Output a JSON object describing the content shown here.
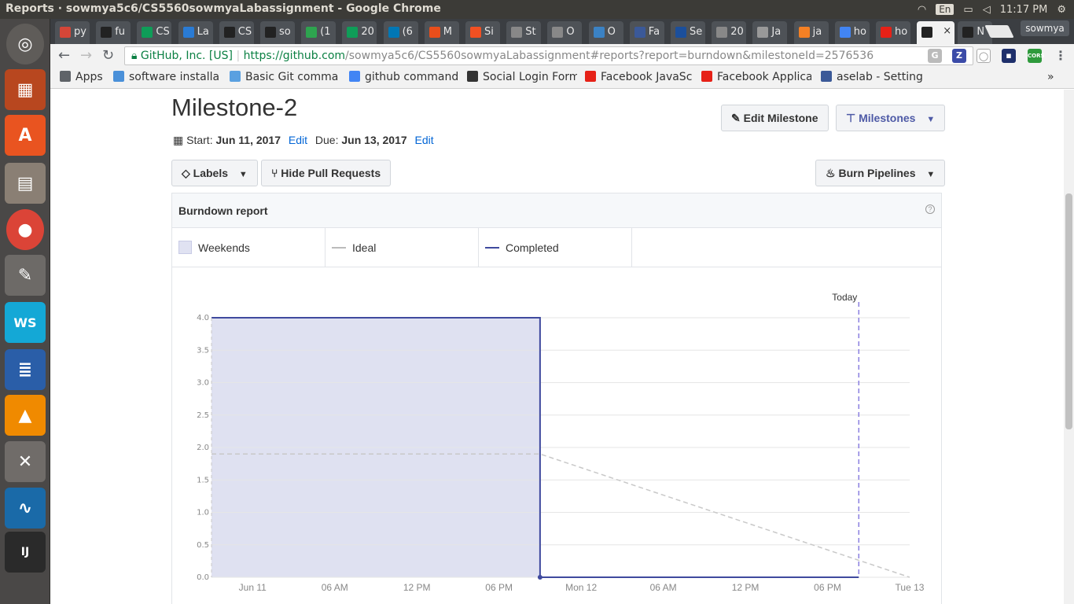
{
  "os": {
    "window_title": "Reports · sowmya5c6/CS5560sowmyaLabassignment - Google Chrome",
    "input_lang": "En",
    "clock": "11:17 PM"
  },
  "browser": {
    "tabs": [
      {
        "label": "py",
        "icon": "gmail-icon",
        "color": "#d44638"
      },
      {
        "label": "fu",
        "icon": "github-icon",
        "color": "#222"
      },
      {
        "label": "CS",
        "icon": "sheets-icon",
        "color": "#0f9d58"
      },
      {
        "label": "La",
        "icon": "blogger-icon",
        "color": "#2a7bd4"
      },
      {
        "label": "CS",
        "icon": "github-icon",
        "color": "#222"
      },
      {
        "label": "so",
        "icon": "github-icon",
        "color": "#222"
      },
      {
        "label": "(1",
        "icon": "badge-icon",
        "color": "#2ea44f"
      },
      {
        "label": "20",
        "icon": "sheets-icon",
        "color": "#0f9d58"
      },
      {
        "label": "(6",
        "icon": "linkedin-icon",
        "color": "#0077b5"
      },
      {
        "label": "M",
        "icon": "office-icon",
        "color": "#e84e1b"
      },
      {
        "label": "Si",
        "icon": "microsoft-icon",
        "color": "#f25022"
      },
      {
        "label": "St",
        "icon": "page-icon",
        "color": "#888"
      },
      {
        "label": "O",
        "icon": "page-icon",
        "color": "#888"
      },
      {
        "label": "O",
        "icon": "user-icon",
        "color": "#3b82c4"
      },
      {
        "label": "Fa",
        "icon": "facebook-icon",
        "color": "#3b5998"
      },
      {
        "label": "Se",
        "icon": "nav-icon",
        "color": "#1b4f9c"
      },
      {
        "label": "20",
        "icon": "page-icon",
        "color": "#888"
      },
      {
        "label": "Ja",
        "icon": "image-icon",
        "color": "#999"
      },
      {
        "label": "ja",
        "icon": "stackoverflow-icon",
        "color": "#f48024"
      },
      {
        "label": "ho",
        "icon": "google-icon",
        "color": "#4285f4"
      },
      {
        "label": "ho",
        "icon": "youtube-icon",
        "color": "#e62117"
      },
      {
        "label": "",
        "icon": "github-icon",
        "color": "#222"
      },
      {
        "label": "N",
        "icon": "github-icon",
        "color": "#222"
      }
    ],
    "profile": "sowmya",
    "omnibox": {
      "security": "GitHub, Inc. [US]",
      "scheme_host": "https://github.com",
      "path": "/sowmya5c6/CS5560sowmyaLabassignment#reports?report=burndown&milestoneId=2576536"
    },
    "bookmarks": [
      {
        "label": "Apps",
        "color": "#5f6368"
      },
      {
        "label": "software installa",
        "color": "#4a90d9"
      },
      {
        "label": "Basic Git comma",
        "color": "#5aa0e0"
      },
      {
        "label": "github command",
        "color": "#4285f4"
      },
      {
        "label": "Social Login Form",
        "color": "#333"
      },
      {
        "label": "Facebook JavaSc",
        "color": "#e62117"
      },
      {
        "label": "Facebook Applica",
        "color": "#e62117"
      },
      {
        "label": "aselab - Settings",
        "color": "#3b5998"
      }
    ]
  },
  "milestone": {
    "title": "Milestone-2",
    "start_label": "Start:",
    "start_date": "Jun 11, 2017",
    "due_label": "Due:",
    "due_date": "Jun 13, 2017",
    "edit": "Edit",
    "edit_button": "Edit Milestone",
    "milestones_button": "Milestones"
  },
  "toolbar": {
    "labels_button": "Labels",
    "hide_pr_button": "Hide Pull Requests",
    "burn_button": "Burn Pipelines"
  },
  "report": {
    "title": "Burndown report",
    "help": "?",
    "legend": [
      {
        "label": "Weekends",
        "kind": "box"
      },
      {
        "label": "Ideal",
        "kind": "line",
        "color": "#bbbbbb"
      },
      {
        "label": "Completed",
        "kind": "line",
        "color": "#3f4a9e"
      }
    ]
  },
  "chart_data": {
    "type": "line",
    "title": "",
    "xlabel": "",
    "ylabel": "",
    "ylim": [
      0,
      4.0
    ],
    "y_ticks": [
      "0.0",
      "0.5",
      "1.0",
      "1.5",
      "2.0",
      "2.5",
      "3.0",
      "3.5",
      "4.0"
    ],
    "x_range_hours": [
      "Jun 11 00:00",
      "Jun 13 03:00"
    ],
    "x_ticks": [
      "Jun 11",
      "06 AM",
      "12 PM",
      "06 PM",
      "Mon 12",
      "06 AM",
      "12 PM",
      "06 PM",
      "Tue 13"
    ],
    "weekend_band": {
      "from": "Jun 11 00:00",
      "to": "Jun 12 00:00"
    },
    "today_label": "Today",
    "today": "Jun 12 23:17",
    "series": [
      {
        "name": "Ideal",
        "color": "#c8c8c8",
        "style": "dashed",
        "points": [
          [
            "Jun 11 00:00",
            1.9
          ],
          [
            "Jun 12 00:00",
            1.9
          ],
          [
            "Jun 13 03:00",
            0.0
          ]
        ]
      },
      {
        "name": "Completed",
        "color": "#3f4a9e",
        "style": "solid",
        "points": [
          [
            "Jun 11 00:00",
            4.0
          ],
          [
            "Jun 12 00:00",
            4.0
          ],
          [
            "Jun 12 00:00",
            0.0
          ],
          [
            "Jun 12 23:17",
            0.0
          ]
        ]
      }
    ],
    "grid": true
  }
}
